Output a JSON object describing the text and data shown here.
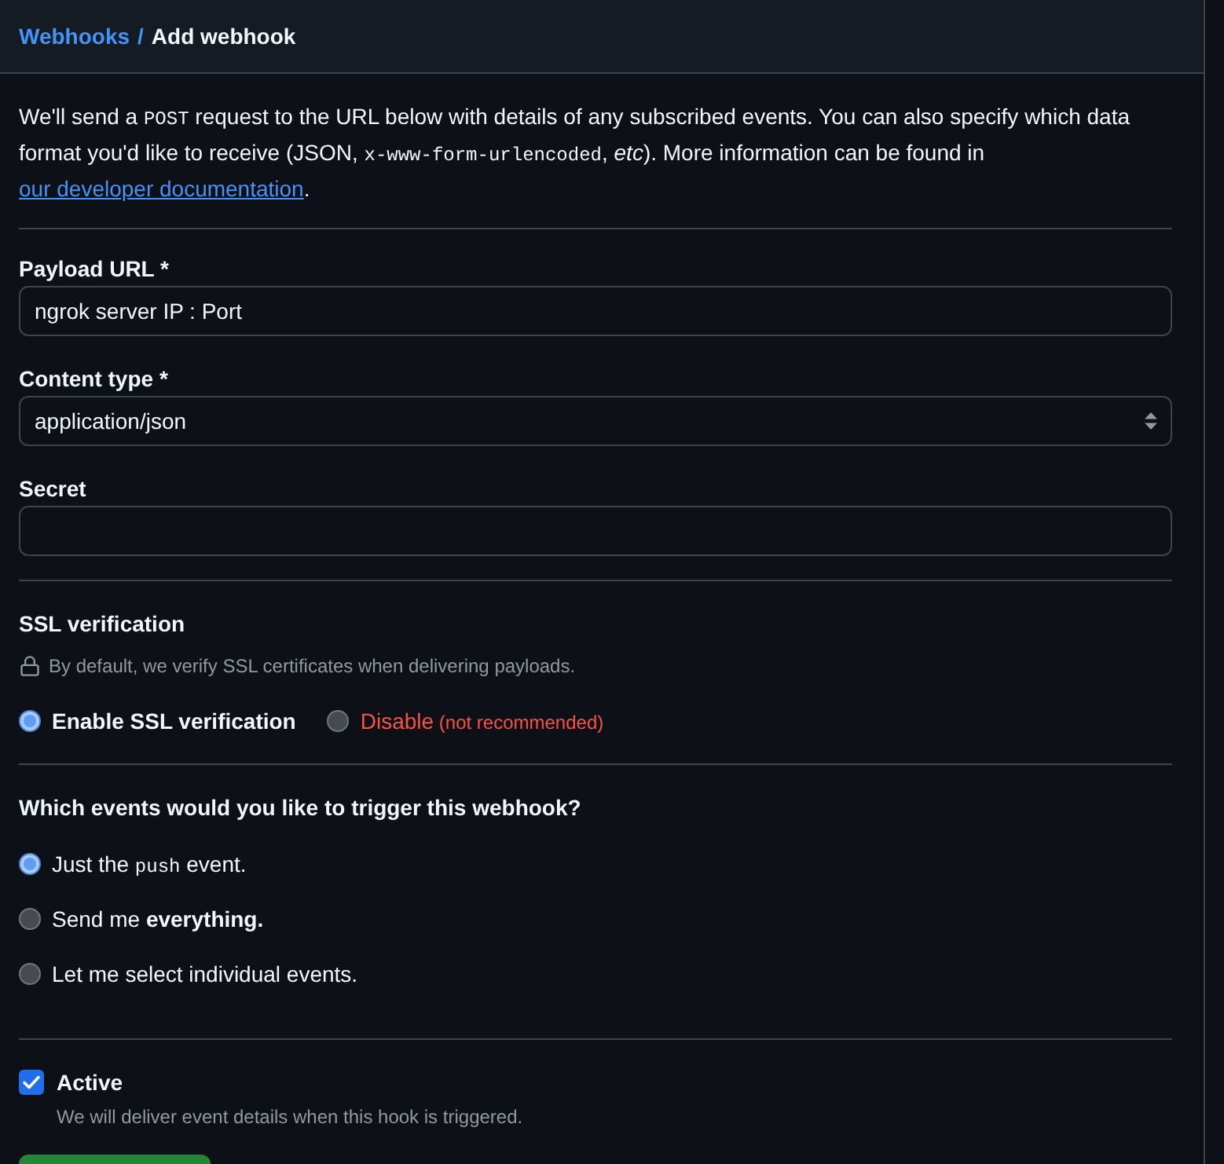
{
  "breadcrumb": {
    "items": [
      {
        "kind": "link",
        "label": "Webhooks"
      },
      {
        "kind": "current",
        "label": "Add webhook"
      }
    ],
    "separator": "/"
  },
  "intro": [
    {
      "kind": "text",
      "text": "We'll send a "
    },
    {
      "kind": "code",
      "text": "POST"
    },
    {
      "kind": "text",
      "text": " request to the URL below with details of any subscribed events. You can also specify which data format you'd like to receive (JSON, "
    },
    {
      "kind": "code",
      "text": "x-www-form-urlencoded"
    },
    {
      "kind": "text",
      "text": ", "
    },
    {
      "kind": "italic",
      "text": "etc"
    },
    {
      "kind": "text",
      "text": "). More information can be found in "
    },
    {
      "kind": "link",
      "text": "our developer documentation"
    },
    {
      "kind": "text",
      "text": "."
    }
  ],
  "fields": [
    {
      "kind": "text",
      "label": "Payload URL *",
      "value": "ngrok server IP : Port"
    },
    {
      "kind": "select",
      "label": "Content type *",
      "value": "application/json"
    },
    {
      "kind": "text",
      "label": "Secret"
    }
  ],
  "ssl": {
    "title": "SSL verification",
    "note": "By default, we verify SSL certificates when delivering payloads.",
    "options": [
      {
        "kind": "strong",
        "label": "Enable SSL verification",
        "selected": true
      },
      {
        "kind": "danger",
        "label": "Disable",
        "hint": "(not recommended)",
        "selected": false
      }
    ]
  },
  "events": {
    "title": "Which events would you like to trigger this webhook?",
    "options": [
      {
        "segments": [
          {
            "kind": "text",
            "text": "Just the "
          },
          {
            "kind": "code",
            "text": "push"
          },
          {
            "kind": "text",
            "text": " event."
          }
        ],
        "selected": true
      },
      {
        "segments": [
          {
            "kind": "text",
            "text": "Send me "
          },
          {
            "kind": "bold",
            "text": "everything."
          }
        ],
        "selected": false
      },
      {
        "segments": [
          {
            "kind": "text",
            "text": "Let me select individual events."
          }
        ],
        "selected": false
      }
    ]
  },
  "active": {
    "label": "Active",
    "checked": true,
    "note": "We will deliver event details when this hook is triggered."
  },
  "footer_button": {
    "kind": "primary"
  }
}
